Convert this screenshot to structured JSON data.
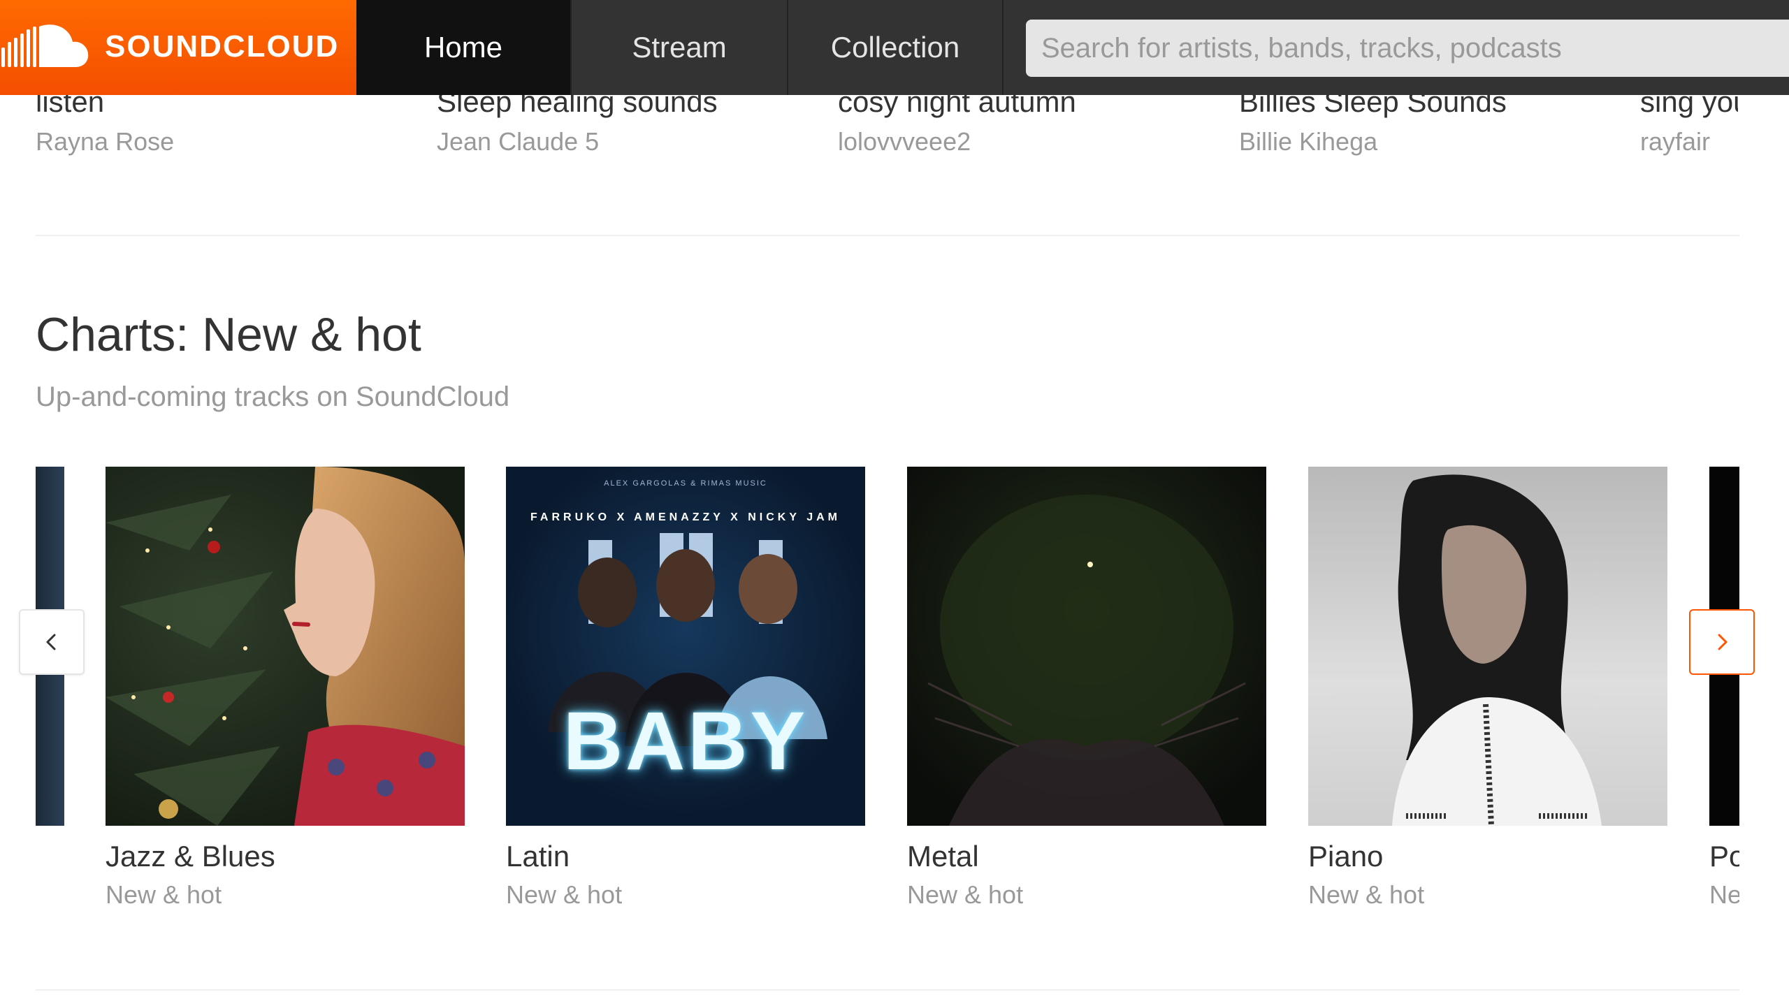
{
  "header": {
    "logo_text": "SOUNDCLOUD",
    "brand_color": "#ff5500",
    "nav": [
      {
        "label": "Home",
        "active": true
      },
      {
        "label": "Stream",
        "active": false
      },
      {
        "label": "Collection",
        "active": false
      }
    ],
    "search": {
      "placeholder": "Search for artists, bands, tracks, podcasts",
      "value": ""
    }
  },
  "previous_row": {
    "items": [
      {
        "title": "listen",
        "artist": "Rayna Rose"
      },
      {
        "title": "Sleep healing sounds",
        "artist": "Jean Claude 5"
      },
      {
        "title": "cosy night autumn",
        "artist": "lolovvveee2"
      },
      {
        "title": "Billies Sleep Sounds",
        "artist": "Billie Kihega"
      },
      {
        "title": "sing you",
        "artist": "rayfair"
      }
    ]
  },
  "charts": {
    "title": "Charts: New & hot",
    "subtitle": "Up-and-coming tracks on SoundCloud",
    "tiles": [
      {
        "title": "Jazz & Blues",
        "subtitle": "New & hot"
      },
      {
        "title": "Latin",
        "subtitle": "New & hot"
      },
      {
        "title": "Metal",
        "subtitle": "New & hot"
      },
      {
        "title": "Piano",
        "subtitle": "New & hot"
      },
      {
        "title": "Pop",
        "subtitle": "New & hot"
      }
    ],
    "latin_art": {
      "label_top": "ALEX GARGOLAS & RIMAS MUSIC",
      "artists": "FARRUKO X AMENAZZY X NICKY JAM",
      "word": "BABY"
    },
    "prev_button_icon": "chevron-left-icon",
    "next_button_icon": "chevron-right-icon"
  }
}
